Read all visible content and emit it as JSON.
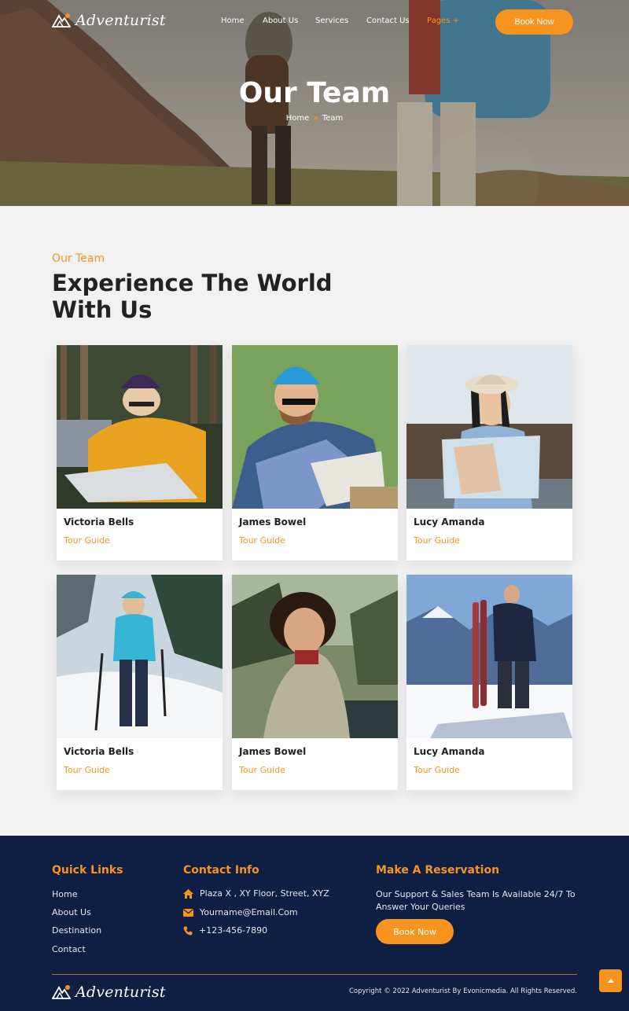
{
  "brand": {
    "name": "Adventurist",
    "accent": "#f7941d",
    "footer_bg": "#0f1e43"
  },
  "nav": {
    "items": [
      {
        "label": "Home"
      },
      {
        "label": "About Us"
      },
      {
        "label": "Services"
      },
      {
        "label": "Contact Us"
      },
      {
        "label": "Pages +"
      }
    ],
    "active_index": 4,
    "book_label": "Book Now"
  },
  "hero": {
    "title": "Our Team",
    "breadcrumb": {
      "home": "Home",
      "sep": "»",
      "current": "Team"
    }
  },
  "team": {
    "eyebrow": "Our Team",
    "title": "Experience The World With Us",
    "members": [
      {
        "name": "Victoria Bells",
        "role": "Tour Guide"
      },
      {
        "name": "James Bowel",
        "role": "Tour Guide"
      },
      {
        "name": "Lucy Amanda",
        "role": "Tour Guide"
      },
      {
        "name": "Victoria Bells",
        "role": "Tour Guide"
      },
      {
        "name": "James Bowel",
        "role": "Tour Guide"
      },
      {
        "name": "Lucy Amanda",
        "role": "Tour Guide"
      }
    ]
  },
  "footer": {
    "quick_links": {
      "heading": "Quick Links",
      "items": [
        "Home",
        "About Us",
        "Destination",
        "Contact"
      ]
    },
    "contact": {
      "heading": "Contact Info",
      "address": "Plaza X , XY Floor, Street, XYZ",
      "email": "Yourname@Email.Com",
      "phone": "+123-456-7890"
    },
    "reservation": {
      "heading": "Make A Reservation",
      "text": "Our Support & Sales Team Is Available 24/7 To Answer Your Queries",
      "button": "Book Now"
    },
    "copyright": "Copyright © 2022 Adventurist By Evonicmedia. All Rights Reserved."
  }
}
